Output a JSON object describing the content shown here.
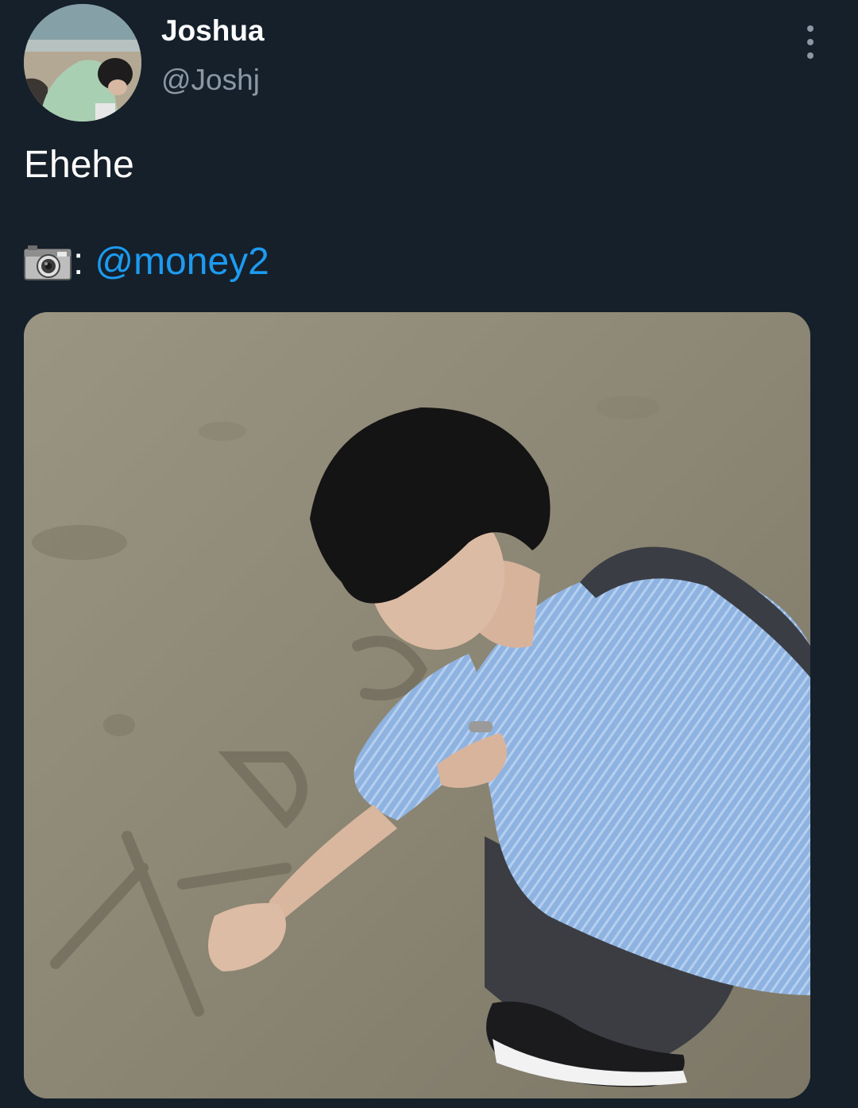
{
  "author": {
    "display_name": "Joshua",
    "handle": "@Joshj"
  },
  "tweet": {
    "text": "Ehehe",
    "credit_separator": ":",
    "mention": "@money2"
  },
  "icons": {
    "credit_icon": "camera-icon",
    "menu_icon": "more-vertical-icon"
  },
  "colors": {
    "background": "#15202b",
    "display_name": "#ffffff",
    "handle": "#8b98a5",
    "mention": "#1d9bf0"
  }
}
